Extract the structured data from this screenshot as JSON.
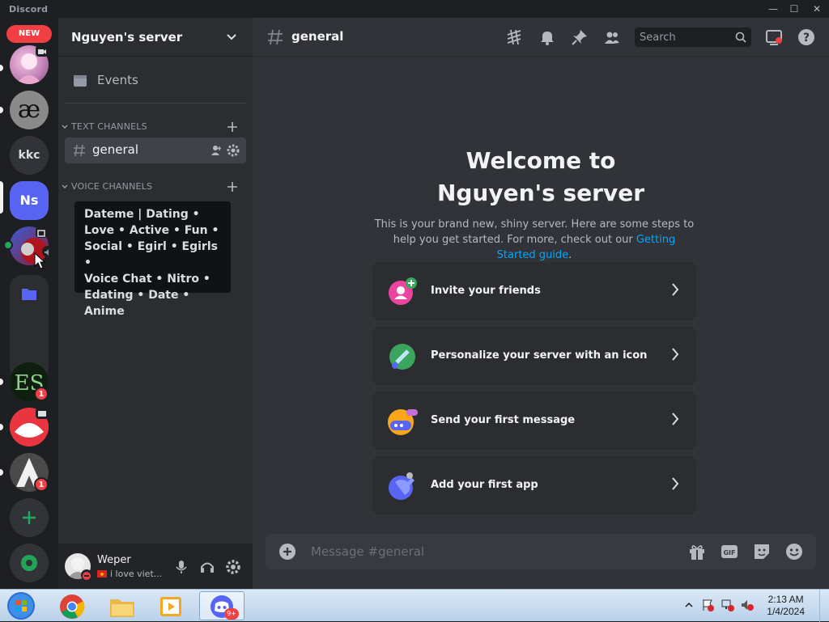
{
  "window": {
    "app_name": "Discord"
  },
  "rail": {
    "new_badge": "NEW",
    "kkc_label": "kkc",
    "ns_label": "Ns",
    "badges": [
      "1",
      "1"
    ]
  },
  "server": {
    "name": "Nguyen's server",
    "events_label": "Events",
    "text_category": "TEXT CHANNELS",
    "voice_category": "VOICE CHANNELS",
    "active_channel": "general",
    "tooltip_lines": [
      "Dateme | Dating •",
      "Love • Active • Fun •",
      "Social • Egirl • Egirls •",
      "Voice Chat • Nitro •",
      "Edating • Date • Anime"
    ]
  },
  "user": {
    "name": "Weper",
    "status": "i love viet..."
  },
  "main": {
    "channel_title": "general",
    "search_placeholder": "Search",
    "welcome_line1": "Welcome to",
    "welcome_line2": "Nguyen's server",
    "welcome_sub_1": "This is your brand new, shiny server. Here are some steps to help you get started. For more, check out our ",
    "welcome_link": "Getting Started guide",
    "welcome_sub_2": ".",
    "cards": [
      {
        "label": "Invite your friends",
        "icon": "invite-icon",
        "color": "#eb459f"
      },
      {
        "label": "Personalize your server with an icon",
        "icon": "brush-icon",
        "color": "#3ba55d"
      },
      {
        "label": "Send your first message",
        "icon": "message-icon",
        "color": "#faa61a"
      },
      {
        "label": "Add your first app",
        "icon": "app-icon",
        "color": "#5865f2"
      }
    ],
    "composer_placeholder": "Message #general"
  },
  "taskbar": {
    "time": "2:13 AM",
    "date": "1/4/2024",
    "discord_badge": "9+"
  },
  "colors": {
    "accent": "#5865f2",
    "link": "#00a8fc",
    "danger": "#f23f43",
    "green": "#23a559"
  }
}
